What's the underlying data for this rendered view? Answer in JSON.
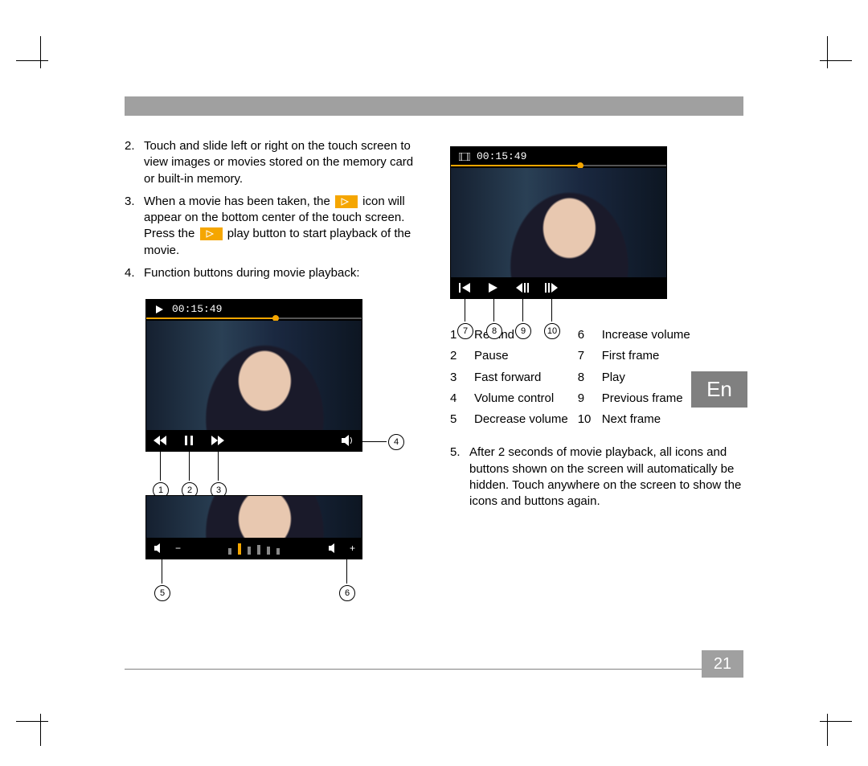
{
  "language_tab": "En",
  "page_number": "21",
  "steps": {
    "s2": {
      "num": "2.",
      "text": "Touch and slide left or right on the touch screen to view images or movies stored on the memory card or built-in memory."
    },
    "s3": {
      "num": "3.",
      "pre": "When a movie has been taken, the ",
      "mid": " icon will appear on the bottom center of the touch screen. Press the ",
      "post": " play button to start playback of the movie."
    },
    "s4": {
      "num": "4.",
      "text": "Function buttons during movie playback:"
    },
    "s5": {
      "num": "5.",
      "text": "After 2 seconds of movie playback, all icons and buttons shown on the screen will automatically be hidden. Touch anywhere on the screen to show the icons and buttons again."
    }
  },
  "time_code": "00:15:49",
  "callouts": {
    "c1": "1",
    "c2": "2",
    "c3": "3",
    "c4": "4",
    "c5": "5",
    "c6": "6",
    "c7": "7",
    "c8": "8",
    "c9": "9",
    "c10": "10"
  },
  "legend": {
    "r1n": "1",
    "r1t": "Rewind",
    "r6n": "6",
    "r6t": "Increase volume",
    "r2n": "2",
    "r2t": "Pause",
    "r7n": "7",
    "r7t": "First frame",
    "r3n": "3",
    "r3t": "Fast forward",
    "r8n": "8",
    "r8t": "Play",
    "r4n": "4",
    "r4t": "Volume control",
    "r9n": "9",
    "r9t": "Previous frame",
    "r5n": "5",
    "r5t": "Decrease volume",
    "r10n": "10",
    "r10t": "Next frame"
  },
  "vol_minus": "−",
  "vol_plus": "+"
}
